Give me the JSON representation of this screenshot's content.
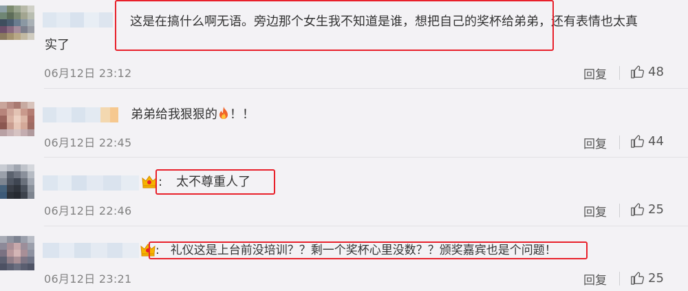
{
  "colors": {
    "accent_red": "#e8202a",
    "background": "#f3f2f5",
    "meta_gray": "#828282"
  },
  "comments": [
    {
      "text_line1": "这是在搞什么啊无语。旁边那个女生我不知道是谁，想把自己的奖杯给弟弟，还有表情也太真",
      "text_line2": "实了",
      "time": "06月12日 23:12",
      "reply": "回复",
      "likes": "48"
    },
    {
      "text_pre": "弟弟给我狠狠的",
      "emoji": "fire-emoji",
      "text_post": "！！",
      "time": "06月12日 22:45",
      "reply": "回复",
      "likes": "44"
    },
    {
      "badge": "crown-icon",
      "text_prefix": ":",
      "text": "太不尊重人了",
      "time": "06月12日 22:46",
      "reply": "回复",
      "likes": "25"
    },
    {
      "badge": "crown-icon",
      "text_prefix": ":",
      "text": "礼仪这是上台前没培训？？剩一个奖杯心里没数？？颁奖嘉宾也是个问题！",
      "time": "06月12日 23:21",
      "reply": "回复",
      "likes": "25"
    }
  ]
}
